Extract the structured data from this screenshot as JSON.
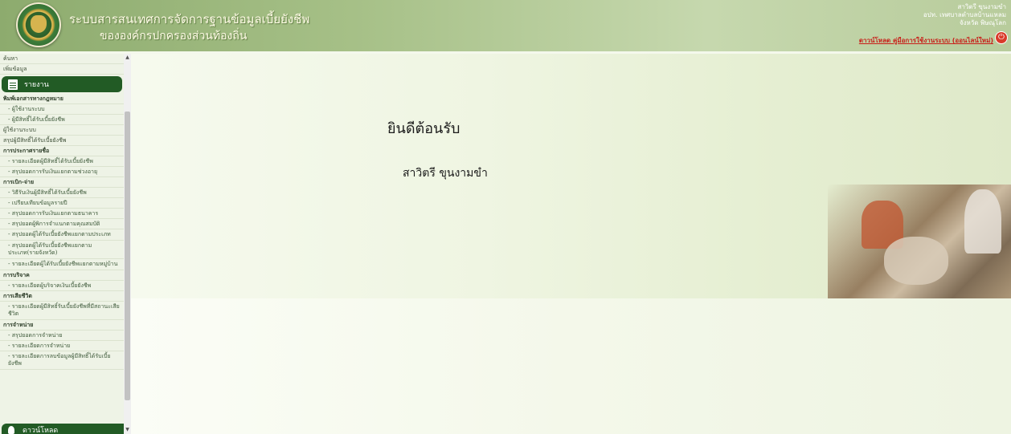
{
  "header": {
    "title_line1": "ระบบสารสนเทศการจัดการฐานข้อมูลเบี้ยยังชีพ",
    "title_line2": "ขององค์กรปกครองส่วนท้องถิ่น",
    "user_name": "สาวิตรี ขุนงามขำ",
    "org_line": "อปท. เทศบาลตำบลบ้านแหลม",
    "province_line": "จังหวัด พิษณุโลก",
    "logout_text": "ดาวน์โหลด คู่มือการใช้งานระบบ (ออนไลน์ใหม่)",
    "power_icon": "power-icon"
  },
  "sidebar": {
    "top_items": [
      "ค้นหา",
      "เพิ่มข้อมูล"
    ],
    "report_header": "รายงาน",
    "items": [
      {
        "label": "พิมพ์เอกสารทางกฎหมาย",
        "type": "bold"
      },
      {
        "label": "- ผู้ใช้งานระบบ",
        "type": "sub"
      },
      {
        "label": "- ผู้มีสิทธิ์ได้รับเบี้ยยังชีพ",
        "type": "sub"
      },
      {
        "label": "ผู้ใช้งานระบบ",
        "type": "normal"
      },
      {
        "label": "สรุปผู้มีสิทธิ์ได้รับเบี้ยยังชีพ",
        "type": "normal"
      },
      {
        "label": "การประกาศรายชื่อ",
        "type": "bold"
      },
      {
        "label": "- รายละเอียดผู้มีสิทธิ์ได้รับเบี้ยยังชีพ",
        "type": "sub"
      },
      {
        "label": "- สรุปยอดการรับเงินแยกตามช่วงอายุ",
        "type": "sub"
      },
      {
        "label": "การเบิก-จ่าย",
        "type": "bold"
      },
      {
        "label": "- วิธีรับเงินผู้มีสิทธิ์ได้รับเบี้ยยังชีพ",
        "type": "sub"
      },
      {
        "label": "- เปรียบเทียบข้อมูลรายปี",
        "type": "sub"
      },
      {
        "label": "- สรุปยอดการรับเงินแยกตามธนาคาร",
        "type": "sub"
      },
      {
        "label": "- สรุปยอดผู้พิการจำแนกตามคุณสมบัติ",
        "type": "sub"
      },
      {
        "label": "- สรุปยอดผู้ได้รับเบี้ยยังชีพแยกตามประเภท",
        "type": "sub-wrap"
      },
      {
        "label": "- สรุปยอดผู้ได้รับเบี้ยยังชีพแยกตามประเภท(รายจังหวัด)",
        "type": "sub-wrap"
      },
      {
        "label": "- รายละเอียดผู้ได้รับเบี้ยยังชีพแยกตามหมู่บ้าน",
        "type": "sub-wrap"
      },
      {
        "label": "การบริจาค",
        "type": "bold"
      },
      {
        "label": "- รายละเอียดผู้บริจาคเงินเบี้ยยังชีพ",
        "type": "sub"
      },
      {
        "label": "การเสียชีวิต",
        "type": "bold"
      },
      {
        "label": "- รายละเอียดผู้มีสิทธิ์รับเบี้ยยังชีพที่มีสถานะเสียชีวิต",
        "type": "sub-wrap"
      },
      {
        "label": "การจำหน่าย",
        "type": "bold"
      },
      {
        "label": "- สรุปยอดการจำหน่าย",
        "type": "sub"
      },
      {
        "label": "- รายละเอียดการจำหน่าย",
        "type": "sub"
      },
      {
        "label": "- รายละเอียดการลบข้อมูลผู้มีสิทธิ์ได้รับเบี้ยยังชีพ",
        "type": "sub-wrap"
      }
    ],
    "footer_label": "ดาวน์โหลด"
  },
  "main": {
    "welcome": "ยินดีต้อนรับ",
    "user_name": "สาวิตรี ขุนงามขำ"
  }
}
